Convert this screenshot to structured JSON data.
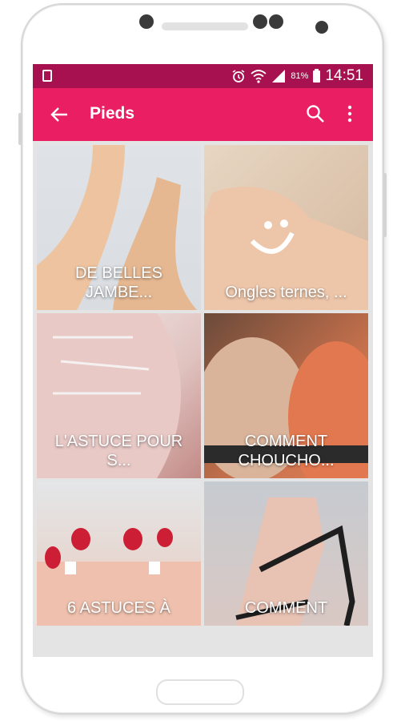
{
  "status_bar": {
    "battery_pct": "81%",
    "time": "14:51",
    "icons": [
      "notification-icon",
      "alarm-icon",
      "wifi-icon",
      "signal-icon",
      "battery-icon"
    ]
  },
  "app_bar": {
    "title": "Pieds",
    "back_icon": "arrow-left-icon",
    "search_icon": "search-icon",
    "menu_icon": "more-vert-icon"
  },
  "colors": {
    "status_bar": "#a8114f",
    "app_bar": "#e91e63",
    "background": "#e4e4e4"
  },
  "tiles": [
    {
      "caption": "DE BELLES\nJAMBE..."
    },
    {
      "caption": "Ongles ternes, ..."
    },
    {
      "caption": "L'ASTUCE POUR\nS..."
    },
    {
      "caption": "COMMENT\nCHOUCHO..."
    },
    {
      "caption": "6 ASTUCES À"
    },
    {
      "caption": "COMMENT"
    }
  ]
}
